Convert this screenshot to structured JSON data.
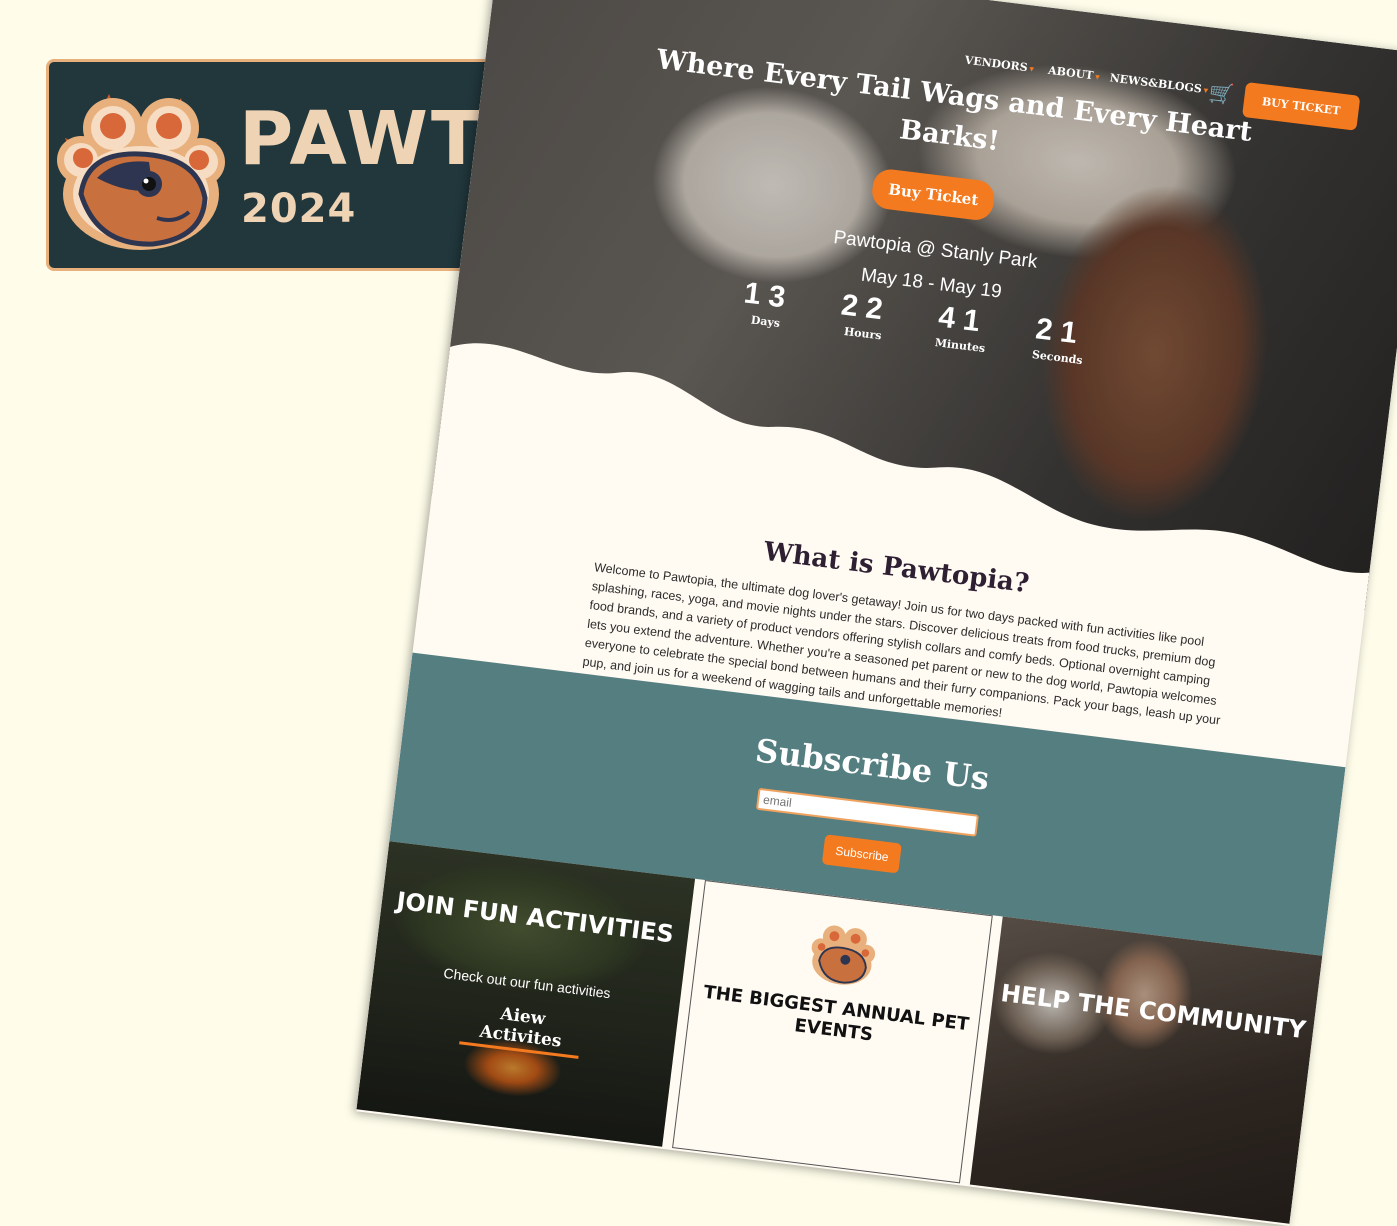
{
  "logo": {
    "title": "PAWTOPIA",
    "year": "2024",
    "icon": "paw-dog-icon"
  },
  "nav": {
    "items": [
      {
        "label": "VENDORS",
        "caret": "▾"
      },
      {
        "label": "ABOUT",
        "caret": "▾"
      },
      {
        "label": "NEWS&BLOGS",
        "caret": "▾"
      }
    ],
    "cart_icon": "cart-icon",
    "cart_glyph": "🛒",
    "buy_label": "BUY TICKET"
  },
  "hero": {
    "title": "Where Every Tail Wags and Every Heart Barks!",
    "button": "Buy Ticket",
    "venue": "Pawtopia @ Stanly Park",
    "dates": "May 18 - May 19",
    "countdown": [
      {
        "value": "13",
        "label": "Days"
      },
      {
        "value": "22",
        "label": "Hours"
      },
      {
        "value": "41",
        "label": "Minutes"
      },
      {
        "value": "21",
        "label": "Seconds"
      }
    ]
  },
  "about": {
    "title": "What is Pawtopia?",
    "text": "Welcome to Pawtopia, the ultimate dog lover's getaway! Join us for two days packed with fun activities like pool splashing, races, yoga, and movie nights under the stars. Discover delicious treats from food trucks, premium dog food brands, and a variety of product vendors offering stylish collars and comfy beds. Optional overnight camping lets you extend the adventure. Whether you're a seasoned pet parent or new to the dog world, Pawtopia welcomes everyone to celebrate the special bond between humans and their furry companions. Pack your bags, leash up your pup, and join us for a weekend of wagging tails and unforgettable memories!"
  },
  "subscribe": {
    "title": "Subscribe Us",
    "placeholder": "email",
    "button": "Subscribe"
  },
  "cards": {
    "activities": {
      "title": "JOIN FUN ACTIVITIES",
      "subtitle": "Check out our fun activities",
      "link": "Aiew Activites"
    },
    "events": {
      "title": "THE BIGGEST ANNUAL PET EVENTS"
    },
    "community": {
      "title": "HELP THE COMMUNITY"
    }
  },
  "colors": {
    "accent": "#f47a1f",
    "teal": "#547e80",
    "logo_bg": "#21373c",
    "logo_text": "#efd3b5",
    "page_bg": "#fffdea"
  }
}
